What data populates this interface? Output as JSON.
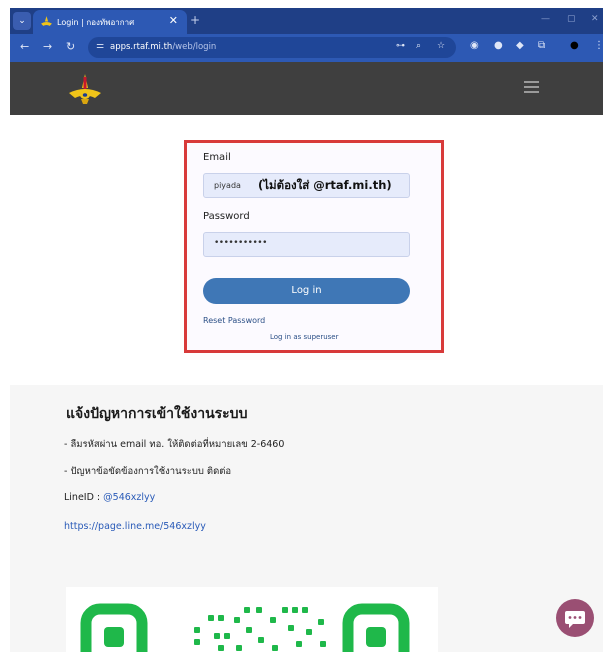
{
  "browser": {
    "tab_title": "Login | กองทัพอากาศ",
    "url_host": "apps.rtaf.mi.th",
    "url_path": "/web/login"
  },
  "login": {
    "email_label": "Email",
    "email_value": "piyada",
    "email_hint": "(ไม่ต้องใส่ @rtaf.mi.th)",
    "password_label": "Password",
    "password_value": "•••••••••••",
    "login_button": "Log in",
    "reset_password": "Reset Password",
    "superuser_link": "Log in as superuser"
  },
  "info": {
    "title": "แจ้งปัญหาการเข้าใช้งานระบบ",
    "line1": "- ลืมรหัสผ่าน email ทอ. ให้ติดต่อที่หมายเลข 2-6460",
    "line2": "- ปัญหาข้อขัดข้องการใช้งานระบบ ติดต่อ",
    "line_id_label": "LineID : ",
    "line_id_value": "@546xzlyy",
    "line_url": "https://page.line.me/546xzlyy"
  },
  "colors": {
    "chrome_blue": "#2d59b4",
    "header_dark": "#3f3f3f",
    "highlight_red": "#d83a3a",
    "button_blue": "#3f77b6",
    "qr_green": "#1fb84a",
    "chat_purple": "#9a4f73"
  }
}
